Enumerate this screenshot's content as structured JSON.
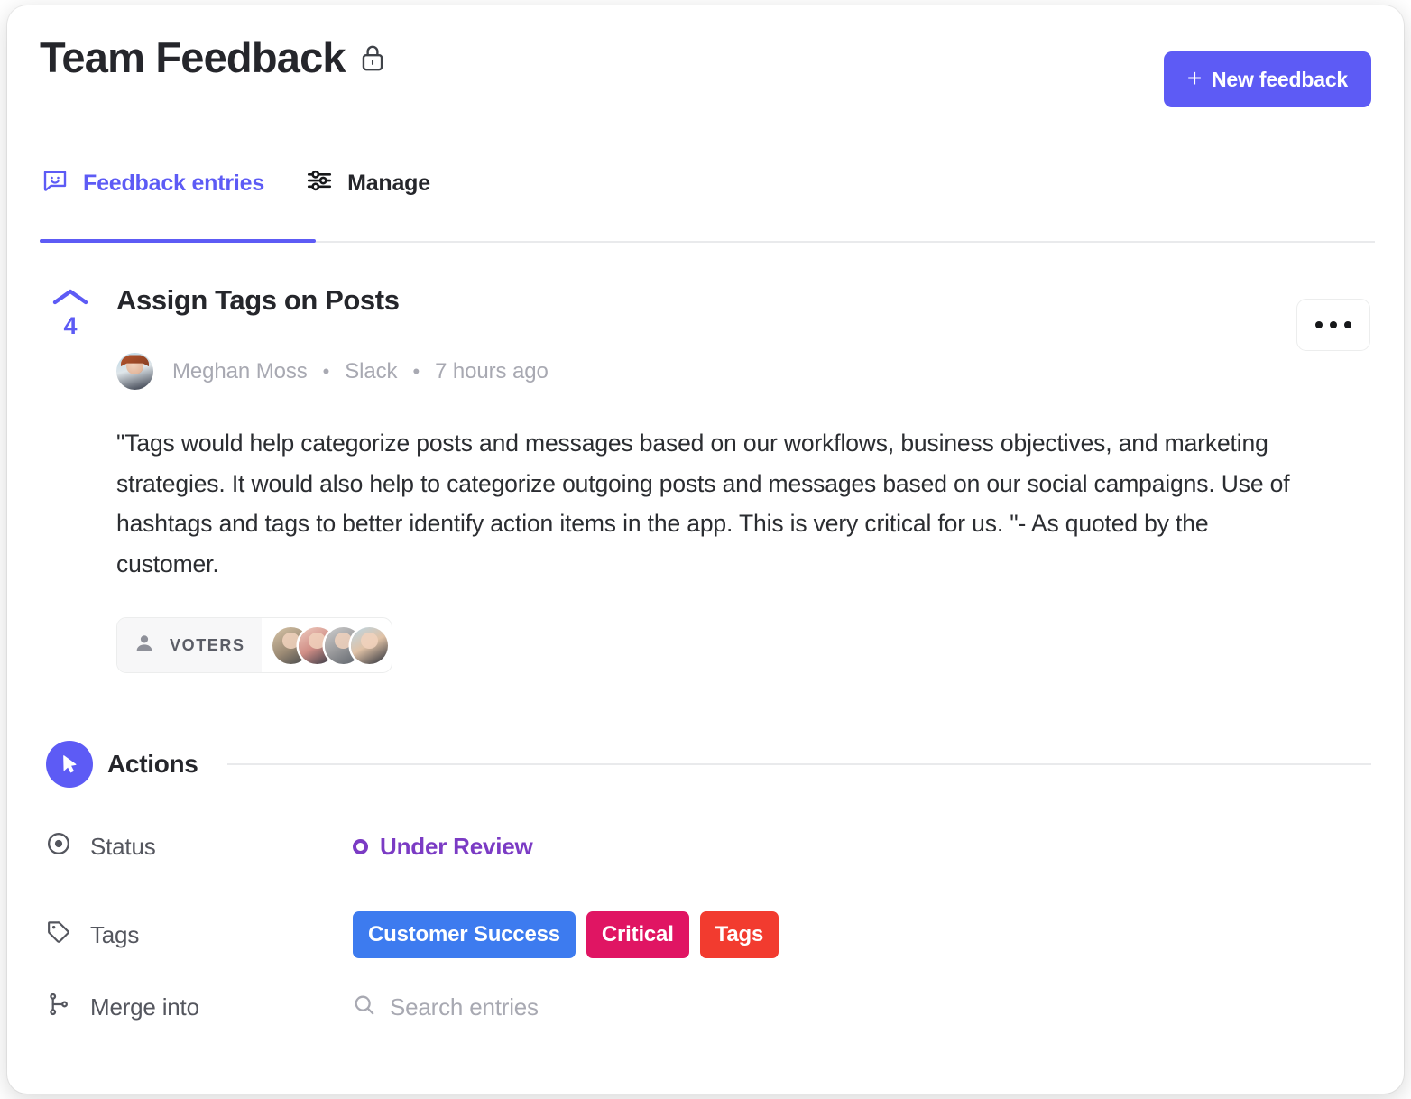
{
  "header": {
    "title": "Team Feedback",
    "lock_icon": "lock-icon",
    "new_feedback_label": "New feedback",
    "plus_glyph": "+",
    "accent_color": "#5d5bf5"
  },
  "tabs": [
    {
      "label": "Feedback entries",
      "icon": "chat-smiley-icon",
      "active": true
    },
    {
      "label": "Manage",
      "icon": "sliders-icon",
      "active": false
    }
  ],
  "entry": {
    "vote_count": "4",
    "vote_icon": "chevron-up-icon",
    "title": "Assign Tags on Posts",
    "author": "Meghan Moss",
    "source": "Slack",
    "timestamp": "7 hours ago",
    "separator": "•",
    "body": "\"Tags would help categorize posts and messages based on our workflows, business objectives, and marketing strategies. It would also help to categorize outgoing posts and messages based on our social campaigns. Use of hashtags and tags to better identify action items in the app. This is very critical for us. \"- As quoted by the customer.",
    "more_menu_icon": "ellipsis-icon",
    "voters": {
      "label": "VOTERS",
      "icon": "person-icon",
      "avatar_count": 4
    }
  },
  "actions": {
    "title": "Actions",
    "icon": "cursor-arrow-icon",
    "status": {
      "label": "Status",
      "icon": "target-dot-icon",
      "value": "Under Review",
      "color": "#7b3bc4"
    },
    "tags": {
      "label": "Tags",
      "icon": "tag-icon",
      "items": [
        {
          "label": "Customer Success",
          "color": "#3d7bef"
        },
        {
          "label": "Critical",
          "color": "#e01563"
        },
        {
          "label": "Tags",
          "color": "#f23b2f"
        }
      ]
    },
    "merge": {
      "label": "Merge into",
      "icon": "merge-branch-icon",
      "search_icon": "search-icon",
      "search_value": "",
      "search_placeholder": "Search entries"
    }
  }
}
